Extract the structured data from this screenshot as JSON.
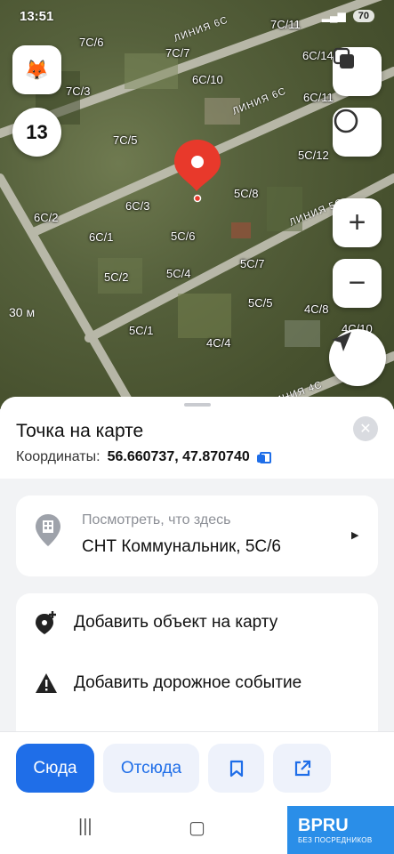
{
  "status_bar": {
    "time": "13:51",
    "battery": "70"
  },
  "map": {
    "zoom_level": "13",
    "scale_label": "30 м",
    "streets": [
      "ЛИНИЯ 6С",
      "ЛИНИЯ 5С",
      "ЛИНИЯ 4С"
    ],
    "labels": [
      "7С/6",
      "7С/7",
      "7С/3",
      "6С/10",
      "7С/5",
      "6С/3",
      "6С/2",
      "6С/1",
      "5С/2",
      "5С/6",
      "5С/8",
      "5С/4",
      "5С/7",
      "5С/5",
      "5С/1",
      "4С/4",
      "4С/8",
      "6С/14",
      "6С/11",
      "5С/12",
      "7С/11",
      "4С/10"
    ],
    "icons": {
      "app": "fox-icon",
      "layers": "layers-icon",
      "mode": "circle-icon",
      "zoom_in": "plus-icon",
      "zoom_out": "minus-icon",
      "locate": "navigation-arrow-icon",
      "pin": "map-pin-icon"
    }
  },
  "sheet": {
    "title": "Точка на карте",
    "coords_label": "Координаты:",
    "coords_value": "56.660737, 47.870740",
    "what_here": {
      "subtitle": "Посмотреть, что здесь",
      "title": "СНТ Коммунальник, 5С/6"
    },
    "actions_list": [
      {
        "label": "Добавить объект на карту",
        "icon": "add-place-icon"
      },
      {
        "label": "Добавить дорожное событие",
        "icon": "warning-icon"
      }
    ]
  },
  "buttons": {
    "here": "Сюда",
    "from": "Отсюда",
    "save_icon": "bookmark-icon",
    "share_icon": "share-icon"
  },
  "watermark": {
    "brand": "BPRU",
    "tagline": "БЕЗ ПОСРЕДНИКОВ"
  },
  "colors": {
    "accent": "#1f6ee8",
    "pin": "#e8392b",
    "watermark": "#2a8ee8"
  }
}
